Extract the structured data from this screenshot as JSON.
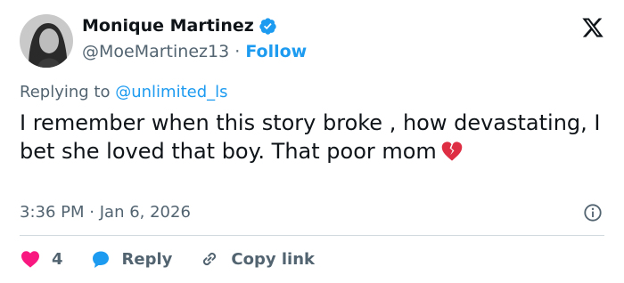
{
  "author": {
    "name": "Monique Martinez",
    "handle": "@MoeMartinez13",
    "separator": "·",
    "follow_label": "Follow",
    "verified": true
  },
  "reply_context": {
    "prefix": "Replying to",
    "mention": "@unlimited_ls"
  },
  "tweet": {
    "text": "I remember when this story broke , how devastating, I bet she loved  that boy.  That poor mom",
    "emoji": "broken-heart-icon"
  },
  "meta": {
    "time": "3:36 PM",
    "separator": "·",
    "date": "Jan 6, 2026"
  },
  "actions": {
    "like_count": "4",
    "reply_label": "Reply",
    "copy_label": "Copy link"
  },
  "colors": {
    "accent": "#1d9bf0",
    "like": "#f91880",
    "muted": "#536471",
    "text": "#0f1419"
  }
}
